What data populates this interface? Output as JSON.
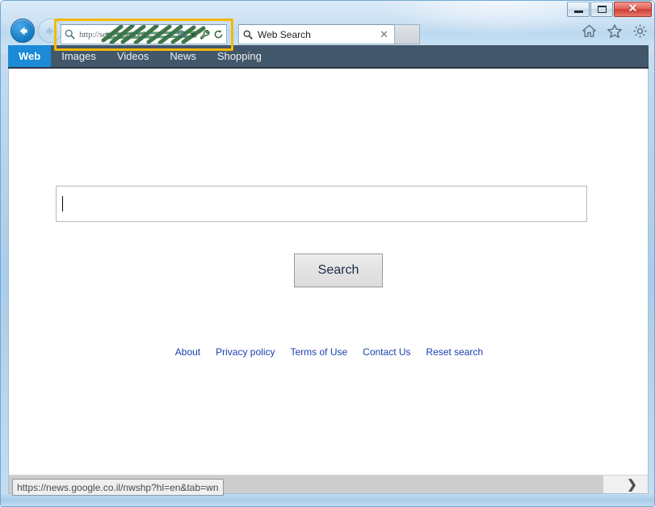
{
  "window": {
    "caption_buttons": [
      {
        "name": "minimize",
        "glyph": "minimize"
      },
      {
        "name": "maximize",
        "glyph": "maximize"
      },
      {
        "name": "close",
        "glyph": "✕"
      }
    ]
  },
  "browser_toolbar": {
    "back_icon": "back-arrow-icon",
    "forward_icon": "forward-arrow-icon",
    "address_bar": {
      "url": "http://search.schoold...",
      "redacted": true,
      "redaction_color": "#2f6b3a",
      "search_icon": "magnifier-icon",
      "trailing_icons": [
        "magnifier-icon",
        "dropdown-arrow-icon",
        "wrench-icon",
        "refresh-icon"
      ],
      "highlight_color": "#f5b800"
    },
    "search_box": {
      "value": "Web Search",
      "placeholder": "Web Search",
      "search_icon": "magnifier-icon",
      "clear_glyph": "✕",
      "go_button_label": ""
    },
    "right_icons": [
      {
        "name": "home-icon"
      },
      {
        "name": "favorites-star-icon"
      },
      {
        "name": "settings-gear-icon"
      }
    ]
  },
  "nav_tabs": {
    "active_color": "#1a8ad9",
    "bar_color": "#43576a",
    "items": [
      {
        "label": "Web",
        "active": true
      },
      {
        "label": "Images",
        "active": false
      },
      {
        "label": "Videos",
        "active": false
      },
      {
        "label": "News",
        "active": false
      },
      {
        "label": "Shopping",
        "active": false
      }
    ]
  },
  "page": {
    "search_input": {
      "value": "",
      "placeholder": ""
    },
    "search_button_label": "Search",
    "footer_links": [
      "About",
      "Privacy policy",
      "Terms of Use",
      "Contact Us",
      "Reset search"
    ]
  },
  "status_bar": {
    "link_tooltip": "https://news.google.co.il/nwshp?hl=en&tab=wn"
  },
  "scrollbar": {
    "right_arrow_glyph": "❯"
  }
}
